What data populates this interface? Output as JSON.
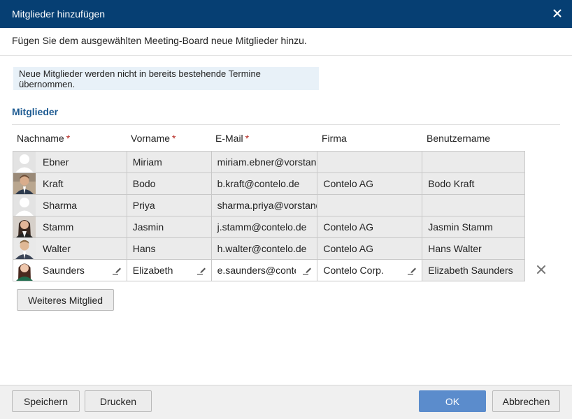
{
  "dialog": {
    "title": "Mitglieder hinzufügen",
    "subtitle": "Fügen Sie dem ausgewählten Meeting-Board neue Mitglieder hinzu.",
    "info": "Neue Mitglieder werden nicht in bereits bestehende Termine übernommen.",
    "section_title": "Mitglieder"
  },
  "columns": {
    "nachname": "Nachname",
    "vorname": "Vorname",
    "email": "E-Mail",
    "firma": "Firma",
    "benutzername": "Benutzername",
    "required_marker": "*"
  },
  "members": [
    {
      "nachname": "Ebner",
      "vorname": "Miriam",
      "email": "miriam.ebner@vorstand",
      "firma": "",
      "benutzername": "",
      "avatar": "placeholder"
    },
    {
      "nachname": "Kraft",
      "vorname": "Bodo",
      "email": "b.kraft@contelo.de",
      "firma": "Contelo AG",
      "benutzername": "Bodo Kraft",
      "avatar": "photo-man-1"
    },
    {
      "nachname": "Sharma",
      "vorname": "Priya",
      "email": "sharma.priya@vorstand",
      "firma": "",
      "benutzername": "",
      "avatar": "placeholder"
    },
    {
      "nachname": "Stamm",
      "vorname": "Jasmin",
      "email": "j.stamm@contelo.de",
      "firma": "Contelo AG",
      "benutzername": "Jasmin Stamm",
      "avatar": "photo-woman-1"
    },
    {
      "nachname": "Walter",
      "vorname": "Hans",
      "email": "h.walter@contelo.de",
      "firma": "Contelo AG",
      "benutzername": "Hans Walter",
      "avatar": "photo-man-2"
    },
    {
      "nachname": "Saunders",
      "vorname": "Elizabeth",
      "email": "e.saunders@contelo.de",
      "firma": "Contelo Corp.",
      "benutzername": "Elizabeth Saunders",
      "avatar": "photo-woman-2"
    }
  ],
  "buttons": {
    "add_member": "Weiteres Mitglied",
    "save": "Speichern",
    "print": "Drucken",
    "ok": "OK",
    "cancel": "Abbrechen"
  },
  "icons": {
    "close": "close-icon",
    "remove_row": "remove-row-icon",
    "edit": "pencil-icon"
  },
  "colors": {
    "titlebar": "#063f73",
    "section_title": "#1f5c93",
    "required": "#b5261e",
    "info_bg": "#e8f1f8",
    "ok_button": "#5b8ccc"
  }
}
